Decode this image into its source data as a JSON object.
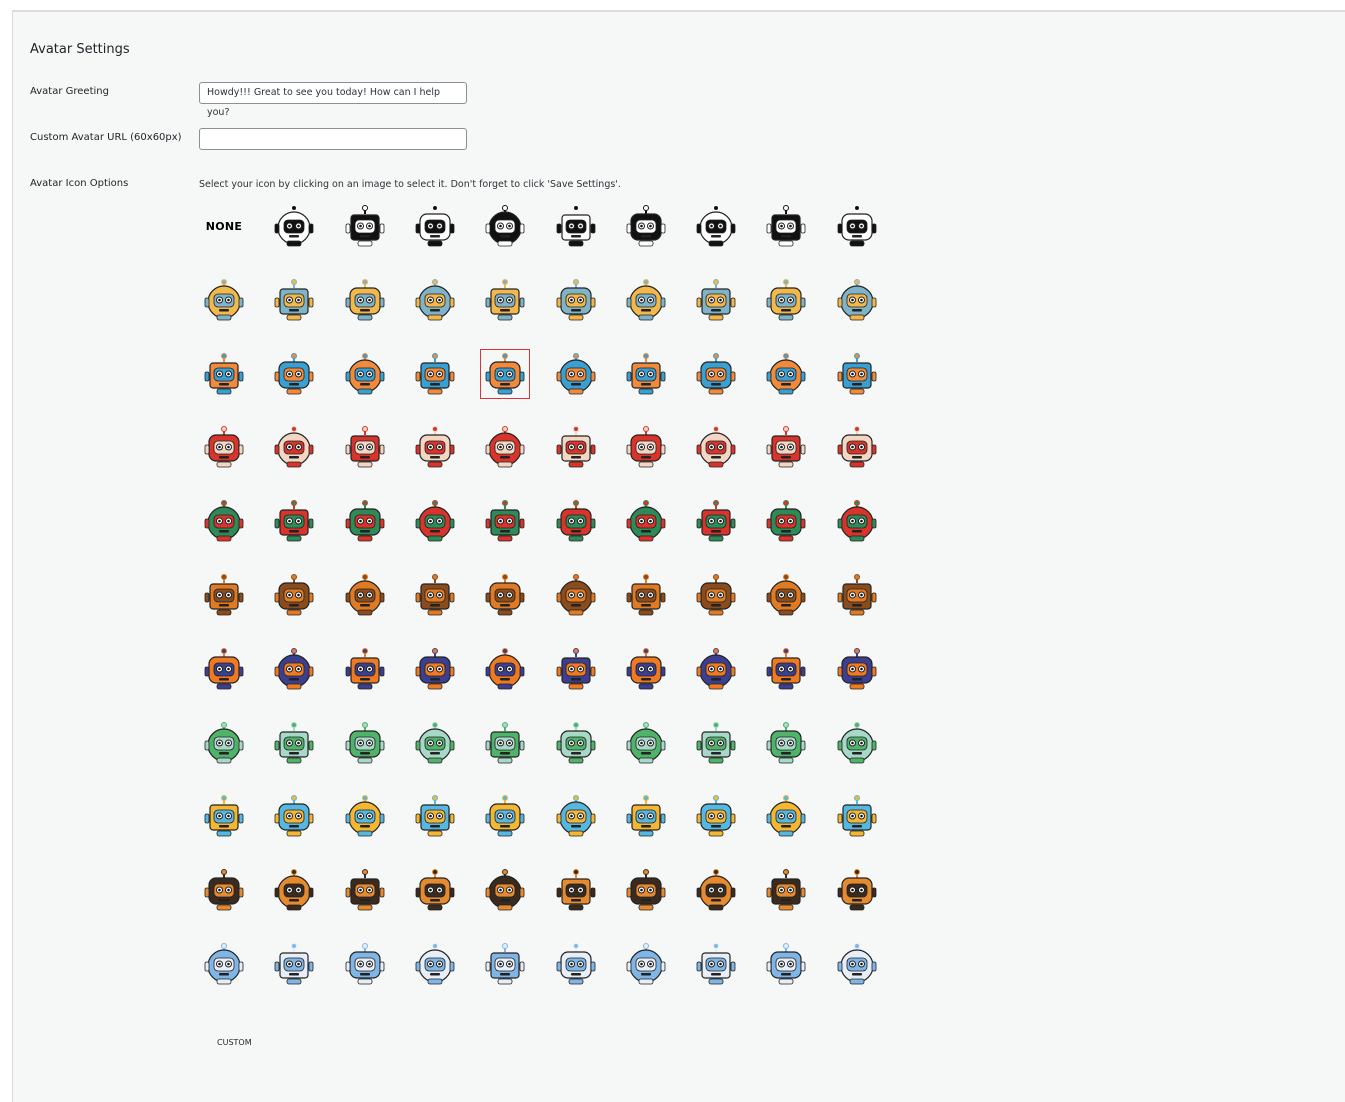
{
  "section_title": "Avatar Settings",
  "fields": {
    "greeting_label": "Avatar Greeting",
    "greeting_value": "Howdy!!! Great to see you today! How can I help you?",
    "custom_url_label": "Custom Avatar URL (60x60px)",
    "custom_url_value": "",
    "icon_options_label": "Avatar Icon Options",
    "icon_options_hint": "Select your icon by clicking on an image to select it. Don't forget to click 'Save Settings'."
  },
  "none_option_label": "NONE",
  "custom_option_label": "CUSTOM",
  "selected_icon_index": 24,
  "icon_rows": [
    {
      "theme": "classic-robots",
      "palette": [
        "#111111",
        "#ffffff"
      ]
    },
    {
      "theme": "character-robots",
      "palette": [
        "#f2b84b",
        "#7fb3c8"
      ]
    },
    {
      "theme": "animal-robots",
      "palette": [
        "#f08a3c",
        "#3a9fd1"
      ]
    },
    {
      "theme": "festive-red",
      "palette": [
        "#d9342b",
        "#f3d7c4"
      ]
    },
    {
      "theme": "christmas",
      "palette": [
        "#2e8b57",
        "#d9342b"
      ]
    },
    {
      "theme": "autumn",
      "palette": [
        "#e07b24",
        "#8a4b1d"
      ]
    },
    {
      "theme": "halloween",
      "palette": [
        "#f07a22",
        "#3c3f8f"
      ]
    },
    {
      "theme": "spring-green",
      "palette": [
        "#4fb36a",
        "#a8d8c8"
      ]
    },
    {
      "theme": "summer-sun",
      "palette": [
        "#f3b733",
        "#56b8e0"
      ]
    },
    {
      "theme": "thanksgiving",
      "palette": [
        "#3b2a1e",
        "#e58a2f"
      ]
    },
    {
      "theme": "winter",
      "palette": [
        "#7fb6e6",
        "#e7eef8"
      ]
    }
  ]
}
